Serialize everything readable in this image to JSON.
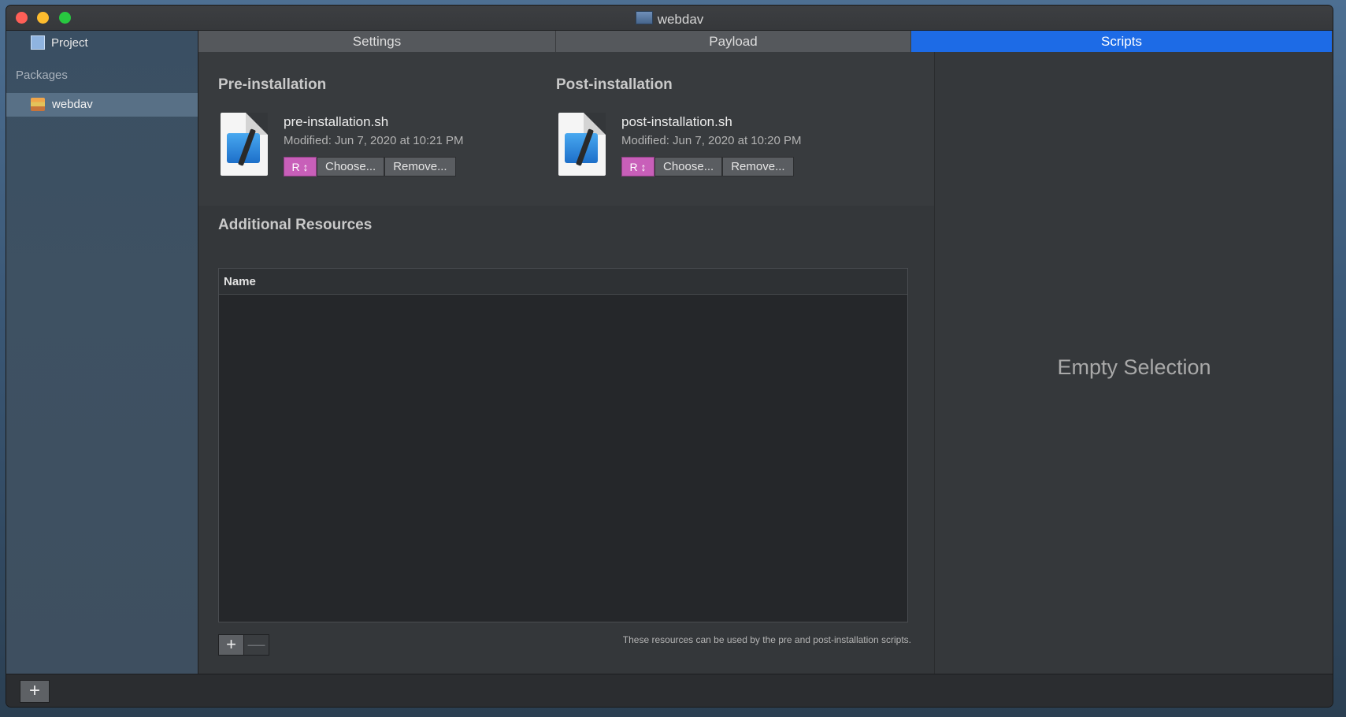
{
  "window": {
    "title": "webdav"
  },
  "sidebar": {
    "project_label": "Project",
    "packages_heading": "Packages",
    "items": [
      {
        "label": "webdav",
        "icon": "package-icon"
      }
    ]
  },
  "tabs": [
    {
      "label": "Settings",
      "active": false
    },
    {
      "label": "Payload",
      "active": false
    },
    {
      "label": "Scripts",
      "active": true
    }
  ],
  "pre_install": {
    "heading": "Pre-installation",
    "filename": "pre-installation.sh",
    "modified": "Modified:  Jun 7, 2020 at 10:21 PM",
    "r_label": "R ↕",
    "choose_label": "Choose...",
    "remove_label": "Remove..."
  },
  "post_install": {
    "heading": "Post-installation",
    "filename": "post-installation.sh",
    "modified": "Modified:  Jun 7, 2020 at 10:20 PM",
    "r_label": "R ↕",
    "choose_label": "Choose...",
    "remove_label": "Remove..."
  },
  "resources": {
    "heading": "Additional Resources",
    "column_name": "Name",
    "add_label": "+",
    "remove_label": "—",
    "hint": "These resources can be used by the pre and post-installation scripts."
  },
  "inspector": {
    "empty_text": "Empty Selection"
  },
  "bottom": {
    "add_label": "+"
  },
  "colors": {
    "accent": "#1d6be6",
    "r_badge": "#c85fb9"
  }
}
